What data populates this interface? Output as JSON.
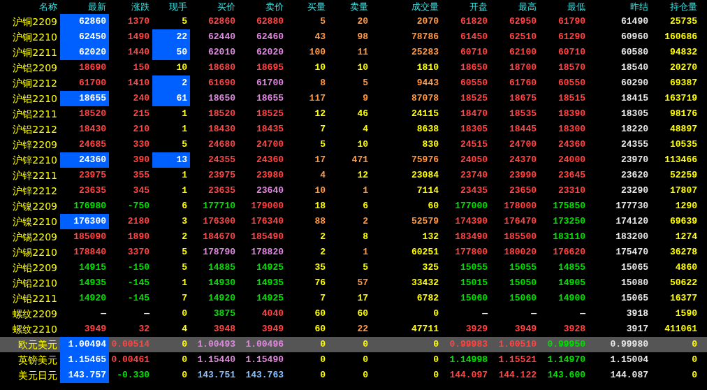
{
  "columns": [
    "名称",
    "最新",
    "涨跌",
    "现手",
    "买价",
    "卖价",
    "买量",
    "卖量",
    "成交量",
    "开盘",
    "最高",
    "最低",
    "昨结",
    "持仓量"
  ],
  "rows": [
    {
      "name": "沪铜2209",
      "selected": false,
      "last_flash": true,
      "hand_flash": false,
      "cells": [
        {
          "text": "62860",
          "color": "#ffffff"
        },
        {
          "text": "1370",
          "color": "#ff4444"
        },
        {
          "text": "5",
          "color": "#ffff00"
        },
        {
          "text": "62860",
          "color": "#ff4444"
        },
        {
          "text": "62880",
          "color": "#ff4444"
        },
        {
          "text": "5",
          "color": "#ff9944"
        },
        {
          "text": "20",
          "color": "#ff9944"
        },
        {
          "text": "2070",
          "color": "#ff9944"
        },
        {
          "text": "61820",
          "color": "#ff4444"
        },
        {
          "text": "62950",
          "color": "#ff4444"
        },
        {
          "text": "61790",
          "color": "#ff4444"
        },
        {
          "text": "61490",
          "color": "#e8e8e8"
        },
        {
          "text": "25735",
          "color": "#ffff00"
        }
      ]
    },
    {
      "name": "沪铜2210",
      "selected": false,
      "last_flash": true,
      "hand_flash": true,
      "cells": [
        {
          "text": "62450",
          "color": "#ffffff"
        },
        {
          "text": "1490",
          "color": "#ff4444"
        },
        {
          "text": "22",
          "color": "#ffffff"
        },
        {
          "text": "62440",
          "color": "#e088e0"
        },
        {
          "text": "62460",
          "color": "#e088e0"
        },
        {
          "text": "43",
          "color": "#ff9944"
        },
        {
          "text": "98",
          "color": "#ff9944"
        },
        {
          "text": "78786",
          "color": "#ff9944"
        },
        {
          "text": "61450",
          "color": "#ff4444"
        },
        {
          "text": "62510",
          "color": "#ff4444"
        },
        {
          "text": "61290",
          "color": "#ff4444"
        },
        {
          "text": "60960",
          "color": "#e8e8e8"
        },
        {
          "text": "160686",
          "color": "#ffff00"
        }
      ]
    },
    {
      "name": "沪铜2211",
      "selected": false,
      "last_flash": true,
      "hand_flash": true,
      "cells": [
        {
          "text": "62020",
          "color": "#ffffff"
        },
        {
          "text": "1440",
          "color": "#ff4444"
        },
        {
          "text": "50",
          "color": "#ffffff"
        },
        {
          "text": "62010",
          "color": "#e088e0"
        },
        {
          "text": "62020",
          "color": "#e088e0"
        },
        {
          "text": "100",
          "color": "#ff9944"
        },
        {
          "text": "11",
          "color": "#ff9944"
        },
        {
          "text": "25283",
          "color": "#ff9944"
        },
        {
          "text": "60710",
          "color": "#ff4444"
        },
        {
          "text": "62100",
          "color": "#ff4444"
        },
        {
          "text": "60710",
          "color": "#ff4444"
        },
        {
          "text": "60580",
          "color": "#e8e8e8"
        },
        {
          "text": "94832",
          "color": "#ffff00"
        }
      ]
    },
    {
      "name": "沪铝2209",
      "selected": false,
      "last_flash": false,
      "hand_flash": false,
      "cells": [
        {
          "text": "18690",
          "color": "#ff4444"
        },
        {
          "text": "150",
          "color": "#ff4444"
        },
        {
          "text": "10",
          "color": "#ffff00"
        },
        {
          "text": "18680",
          "color": "#ff4444"
        },
        {
          "text": "18695",
          "color": "#ff4444"
        },
        {
          "text": "10",
          "color": "#ffff00"
        },
        {
          "text": "10",
          "color": "#ffff00"
        },
        {
          "text": "1810",
          "color": "#ffff00"
        },
        {
          "text": "18650",
          "color": "#ff4444"
        },
        {
          "text": "18700",
          "color": "#ff4444"
        },
        {
          "text": "18570",
          "color": "#ff4444"
        },
        {
          "text": "18540",
          "color": "#e8e8e8"
        },
        {
          "text": "20270",
          "color": "#ffff00"
        }
      ]
    },
    {
      "name": "沪铜2212",
      "selected": false,
      "last_flash": false,
      "hand_flash": true,
      "cells": [
        {
          "text": "61700",
          "color": "#ff4444"
        },
        {
          "text": "1410",
          "color": "#ff4444"
        },
        {
          "text": "2",
          "color": "#ffffff"
        },
        {
          "text": "61690",
          "color": "#ff4444"
        },
        {
          "text": "61700",
          "color": "#e088e0"
        },
        {
          "text": "8",
          "color": "#ff9944"
        },
        {
          "text": "5",
          "color": "#ff9944"
        },
        {
          "text": "9443",
          "color": "#ff9944"
        },
        {
          "text": "60550",
          "color": "#ff4444"
        },
        {
          "text": "61760",
          "color": "#ff4444"
        },
        {
          "text": "60550",
          "color": "#ff4444"
        },
        {
          "text": "60290",
          "color": "#e8e8e8"
        },
        {
          "text": "69387",
          "color": "#ffff00"
        }
      ]
    },
    {
      "name": "沪铝2210",
      "selected": false,
      "last_flash": true,
      "hand_flash": true,
      "cells": [
        {
          "text": "18655",
          "color": "#ffffff"
        },
        {
          "text": "240",
          "color": "#ff4444"
        },
        {
          "text": "61",
          "color": "#ffffff"
        },
        {
          "text": "18650",
          "color": "#e088e0"
        },
        {
          "text": "18655",
          "color": "#e088e0"
        },
        {
          "text": "117",
          "color": "#ff9944"
        },
        {
          "text": "9",
          "color": "#ff9944"
        },
        {
          "text": "87078",
          "color": "#ff9944"
        },
        {
          "text": "18525",
          "color": "#ff4444"
        },
        {
          "text": "18675",
          "color": "#ff4444"
        },
        {
          "text": "18515",
          "color": "#ff4444"
        },
        {
          "text": "18415",
          "color": "#e8e8e8"
        },
        {
          "text": "163719",
          "color": "#ffff00"
        }
      ]
    },
    {
      "name": "沪铝2211",
      "selected": false,
      "last_flash": false,
      "hand_flash": false,
      "cells": [
        {
          "text": "18520",
          "color": "#ff4444"
        },
        {
          "text": "215",
          "color": "#ff4444"
        },
        {
          "text": "1",
          "color": "#ffff00"
        },
        {
          "text": "18520",
          "color": "#ff4444"
        },
        {
          "text": "18525",
          "color": "#ff4444"
        },
        {
          "text": "12",
          "color": "#ffff00"
        },
        {
          "text": "46",
          "color": "#ffff00"
        },
        {
          "text": "24115",
          "color": "#ffff00"
        },
        {
          "text": "18470",
          "color": "#ff4444"
        },
        {
          "text": "18535",
          "color": "#ff4444"
        },
        {
          "text": "18390",
          "color": "#ff4444"
        },
        {
          "text": "18305",
          "color": "#e8e8e8"
        },
        {
          "text": "98176",
          "color": "#ffff00"
        }
      ]
    },
    {
      "name": "沪铝2212",
      "selected": false,
      "last_flash": false,
      "hand_flash": false,
      "cells": [
        {
          "text": "18430",
          "color": "#ff4444"
        },
        {
          "text": "210",
          "color": "#ff4444"
        },
        {
          "text": "1",
          "color": "#ffff00"
        },
        {
          "text": "18430",
          "color": "#ff4444"
        },
        {
          "text": "18435",
          "color": "#ff4444"
        },
        {
          "text": "7",
          "color": "#ffff00"
        },
        {
          "text": "4",
          "color": "#ffff00"
        },
        {
          "text": "8638",
          "color": "#ffff00"
        },
        {
          "text": "18305",
          "color": "#ff4444"
        },
        {
          "text": "18445",
          "color": "#ff4444"
        },
        {
          "text": "18300",
          "color": "#ff4444"
        },
        {
          "text": "18220",
          "color": "#e8e8e8"
        },
        {
          "text": "48897",
          "color": "#ffff00"
        }
      ]
    },
    {
      "name": "沪锌2209",
      "selected": false,
      "last_flash": false,
      "hand_flash": false,
      "cells": [
        {
          "text": "24685",
          "color": "#ff4444"
        },
        {
          "text": "330",
          "color": "#ff4444"
        },
        {
          "text": "5",
          "color": "#ffff00"
        },
        {
          "text": "24680",
          "color": "#ff4444"
        },
        {
          "text": "24700",
          "color": "#ff4444"
        },
        {
          "text": "5",
          "color": "#ffff00"
        },
        {
          "text": "10",
          "color": "#ffff00"
        },
        {
          "text": "830",
          "color": "#ffff00"
        },
        {
          "text": "24515",
          "color": "#ff4444"
        },
        {
          "text": "24700",
          "color": "#ff4444"
        },
        {
          "text": "24360",
          "color": "#ff4444"
        },
        {
          "text": "24355",
          "color": "#e8e8e8"
        },
        {
          "text": "10535",
          "color": "#ffff00"
        }
      ]
    },
    {
      "name": "沪锌2210",
      "selected": false,
      "last_flash": true,
      "hand_flash": true,
      "cells": [
        {
          "text": "24360",
          "color": "#ffffff"
        },
        {
          "text": "390",
          "color": "#ff4444"
        },
        {
          "text": "13",
          "color": "#ffffff"
        },
        {
          "text": "24355",
          "color": "#ff4444"
        },
        {
          "text": "24360",
          "color": "#ff4444"
        },
        {
          "text": "17",
          "color": "#ff9944"
        },
        {
          "text": "471",
          "color": "#ff9944"
        },
        {
          "text": "75976",
          "color": "#ff9944"
        },
        {
          "text": "24050",
          "color": "#ff4444"
        },
        {
          "text": "24370",
          "color": "#ff4444"
        },
        {
          "text": "24000",
          "color": "#ff4444"
        },
        {
          "text": "23970",
          "color": "#e8e8e8"
        },
        {
          "text": "113466",
          "color": "#ffff00"
        }
      ]
    },
    {
      "name": "沪锌2211",
      "selected": false,
      "last_flash": false,
      "hand_flash": false,
      "cells": [
        {
          "text": "23975",
          "color": "#ff4444"
        },
        {
          "text": "355",
          "color": "#ff4444"
        },
        {
          "text": "1",
          "color": "#ffff00"
        },
        {
          "text": "23975",
          "color": "#ff4444"
        },
        {
          "text": "23980",
          "color": "#ff4444"
        },
        {
          "text": "4",
          "color": "#ff9944"
        },
        {
          "text": "12",
          "color": "#ffff00"
        },
        {
          "text": "23084",
          "color": "#ffff00"
        },
        {
          "text": "23740",
          "color": "#ff4444"
        },
        {
          "text": "23990",
          "color": "#ff4444"
        },
        {
          "text": "23645",
          "color": "#ff4444"
        },
        {
          "text": "23620",
          "color": "#e8e8e8"
        },
        {
          "text": "52259",
          "color": "#ffff00"
        }
      ]
    },
    {
      "name": "沪锌2212",
      "selected": false,
      "last_flash": false,
      "hand_flash": false,
      "cells": [
        {
          "text": "23635",
          "color": "#ff4444"
        },
        {
          "text": "345",
          "color": "#ff4444"
        },
        {
          "text": "1",
          "color": "#ffff00"
        },
        {
          "text": "23635",
          "color": "#ff4444"
        },
        {
          "text": "23640",
          "color": "#e088e0"
        },
        {
          "text": "10",
          "color": "#ff9944"
        },
        {
          "text": "1",
          "color": "#ff9944"
        },
        {
          "text": "7114",
          "color": "#ffff00"
        },
        {
          "text": "23435",
          "color": "#ff4444"
        },
        {
          "text": "23650",
          "color": "#ff4444"
        },
        {
          "text": "23310",
          "color": "#ff4444"
        },
        {
          "text": "23290",
          "color": "#e8e8e8"
        },
        {
          "text": "17807",
          "color": "#ffff00"
        }
      ]
    },
    {
      "name": "沪镍2209",
      "selected": false,
      "last_flash": false,
      "hand_flash": false,
      "cells": [
        {
          "text": "176980",
          "color": "#00e000"
        },
        {
          "text": "-750",
          "color": "#00e000"
        },
        {
          "text": "6",
          "color": "#ffff00"
        },
        {
          "text": "177710",
          "color": "#00e000"
        },
        {
          "text": "179000",
          "color": "#ff4444"
        },
        {
          "text": "18",
          "color": "#ffff00"
        },
        {
          "text": "6",
          "color": "#ffff00"
        },
        {
          "text": "60",
          "color": "#ffff00"
        },
        {
          "text": "177000",
          "color": "#00e000"
        },
        {
          "text": "178000",
          "color": "#ff4444"
        },
        {
          "text": "175850",
          "color": "#00e000"
        },
        {
          "text": "177730",
          "color": "#e8e8e8"
        },
        {
          "text": "1290",
          "color": "#ffff00"
        }
      ]
    },
    {
      "name": "沪镍2210",
      "selected": false,
      "last_flash": true,
      "hand_flash": false,
      "cells": [
        {
          "text": "176300",
          "color": "#ffffff"
        },
        {
          "text": "2180",
          "color": "#ff4444"
        },
        {
          "text": "3",
          "color": "#ffff00"
        },
        {
          "text": "176300",
          "color": "#ff4444"
        },
        {
          "text": "176340",
          "color": "#ff4444"
        },
        {
          "text": "88",
          "color": "#ff9944"
        },
        {
          "text": "2",
          "color": "#ff9944"
        },
        {
          "text": "52579",
          "color": "#ff9944"
        },
        {
          "text": "174390",
          "color": "#ff4444"
        },
        {
          "text": "176470",
          "color": "#ff4444"
        },
        {
          "text": "173250",
          "color": "#00e000"
        },
        {
          "text": "174120",
          "color": "#e8e8e8"
        },
        {
          "text": "69639",
          "color": "#ffff00"
        }
      ]
    },
    {
      "name": "沪锡2209",
      "selected": false,
      "last_flash": false,
      "hand_flash": false,
      "cells": [
        {
          "text": "185090",
          "color": "#ff4444"
        },
        {
          "text": "1890",
          "color": "#ff4444"
        },
        {
          "text": "2",
          "color": "#ffff00"
        },
        {
          "text": "184670",
          "color": "#ff4444"
        },
        {
          "text": "185490",
          "color": "#ff4444"
        },
        {
          "text": "2",
          "color": "#ffff00"
        },
        {
          "text": "8",
          "color": "#ffff00"
        },
        {
          "text": "132",
          "color": "#ffff00"
        },
        {
          "text": "183490",
          "color": "#ff4444"
        },
        {
          "text": "185500",
          "color": "#ff4444"
        },
        {
          "text": "183110",
          "color": "#00e000"
        },
        {
          "text": "183200",
          "color": "#e8e8e8"
        },
        {
          "text": "1274",
          "color": "#ffff00"
        }
      ]
    },
    {
      "name": "沪锡2210",
      "selected": false,
      "last_flash": false,
      "hand_flash": false,
      "cells": [
        {
          "text": "178840",
          "color": "#ff4444"
        },
        {
          "text": "3370",
          "color": "#ff4444"
        },
        {
          "text": "5",
          "color": "#ffff00"
        },
        {
          "text": "178790",
          "color": "#e088e0"
        },
        {
          "text": "178820",
          "color": "#e088e0"
        },
        {
          "text": "2",
          "color": "#ffff00"
        },
        {
          "text": "1",
          "color": "#ff9944"
        },
        {
          "text": "60251",
          "color": "#ffff00"
        },
        {
          "text": "177800",
          "color": "#ff4444"
        },
        {
          "text": "180020",
          "color": "#ff4444"
        },
        {
          "text": "176620",
          "color": "#ff4444"
        },
        {
          "text": "175470",
          "color": "#e8e8e8"
        },
        {
          "text": "36278",
          "color": "#ffff00"
        }
      ]
    },
    {
      "name": "沪铅2209",
      "selected": false,
      "last_flash": false,
      "hand_flash": false,
      "cells": [
        {
          "text": "14915",
          "color": "#00e000"
        },
        {
          "text": "-150",
          "color": "#00e000"
        },
        {
          "text": "5",
          "color": "#ffff00"
        },
        {
          "text": "14885",
          "color": "#00e000"
        },
        {
          "text": "14925",
          "color": "#00e000"
        },
        {
          "text": "35",
          "color": "#ffff00"
        },
        {
          "text": "5",
          "color": "#ffff00"
        },
        {
          "text": "325",
          "color": "#ffff00"
        },
        {
          "text": "15055",
          "color": "#00e000"
        },
        {
          "text": "15055",
          "color": "#00e000"
        },
        {
          "text": "14855",
          "color": "#00e000"
        },
        {
          "text": "15065",
          "color": "#e8e8e8"
        },
        {
          "text": "4860",
          "color": "#ffff00"
        }
      ]
    },
    {
      "name": "沪铅2210",
      "selected": false,
      "last_flash": false,
      "hand_flash": false,
      "cells": [
        {
          "text": "14935",
          "color": "#00e000"
        },
        {
          "text": "-145",
          "color": "#00e000"
        },
        {
          "text": "1",
          "color": "#ffff00"
        },
        {
          "text": "14930",
          "color": "#00e000"
        },
        {
          "text": "14935",
          "color": "#00e000"
        },
        {
          "text": "76",
          "color": "#ffff00"
        },
        {
          "text": "57",
          "color": "#ff9944"
        },
        {
          "text": "33432",
          "color": "#ffff00"
        },
        {
          "text": "15015",
          "color": "#00e000"
        },
        {
          "text": "15050",
          "color": "#00e000"
        },
        {
          "text": "14905",
          "color": "#00e000"
        },
        {
          "text": "15080",
          "color": "#e8e8e8"
        },
        {
          "text": "50622",
          "color": "#ffff00"
        }
      ]
    },
    {
      "name": "沪铅2211",
      "selected": false,
      "last_flash": false,
      "hand_flash": false,
      "cells": [
        {
          "text": "14920",
          "color": "#00e000"
        },
        {
          "text": "-145",
          "color": "#00e000"
        },
        {
          "text": "7",
          "color": "#ffff00"
        },
        {
          "text": "14920",
          "color": "#00e000"
        },
        {
          "text": "14925",
          "color": "#00e000"
        },
        {
          "text": "7",
          "color": "#ffff00"
        },
        {
          "text": "17",
          "color": "#ffff00"
        },
        {
          "text": "6782",
          "color": "#ffff00"
        },
        {
          "text": "15060",
          "color": "#00e000"
        },
        {
          "text": "15060",
          "color": "#00e000"
        },
        {
          "text": "14900",
          "color": "#00e000"
        },
        {
          "text": "15065",
          "color": "#e8e8e8"
        },
        {
          "text": "16377",
          "color": "#ffff00"
        }
      ]
    },
    {
      "name": "螺纹2209",
      "selected": false,
      "last_flash": false,
      "hand_flash": false,
      "cells": [
        {
          "text": "—",
          "color": "#e8e8e8"
        },
        {
          "text": "—",
          "color": "#e8e8e8"
        },
        {
          "text": "0",
          "color": "#ffff00"
        },
        {
          "text": "3875",
          "color": "#00e000"
        },
        {
          "text": "4040",
          "color": "#ff4444"
        },
        {
          "text": "60",
          "color": "#ffff00"
        },
        {
          "text": "60",
          "color": "#ffff00"
        },
        {
          "text": "0",
          "color": "#ffff00"
        },
        {
          "text": "—",
          "color": "#e8e8e8"
        },
        {
          "text": "—",
          "color": "#e8e8e8"
        },
        {
          "text": "—",
          "color": "#e8e8e8"
        },
        {
          "text": "3918",
          "color": "#e8e8e8"
        },
        {
          "text": "1590",
          "color": "#ffff00"
        }
      ]
    },
    {
      "name": "螺纹2210",
      "selected": false,
      "last_flash": false,
      "hand_flash": false,
      "cells": [
        {
          "text": "3949",
          "color": "#ff4444"
        },
        {
          "text": "32",
          "color": "#ff4444"
        },
        {
          "text": "4",
          "color": "#ffff00"
        },
        {
          "text": "3948",
          "color": "#ff4444"
        },
        {
          "text": "3949",
          "color": "#ff4444"
        },
        {
          "text": "60",
          "color": "#ffff00"
        },
        {
          "text": "22",
          "color": "#ff9944"
        },
        {
          "text": "47711",
          "color": "#ffff00"
        },
        {
          "text": "3929",
          "color": "#ff4444"
        },
        {
          "text": "3949",
          "color": "#ff4444"
        },
        {
          "text": "3928",
          "color": "#ff4444"
        },
        {
          "text": "3917",
          "color": "#e8e8e8"
        },
        {
          "text": "411061",
          "color": "#ffff00"
        }
      ]
    },
    {
      "name": "欧元美元",
      "selected": true,
      "last_flash": true,
      "hand_flash": false,
      "cells": [
        {
          "text": "1.00494",
          "color": "#ffffff"
        },
        {
          "text": "0.00514",
          "color": "#ff4444"
        },
        {
          "text": "0",
          "color": "#ffff00"
        },
        {
          "text": "1.00493",
          "color": "#e088e0"
        },
        {
          "text": "1.00496",
          "color": "#e088e0"
        },
        {
          "text": "0",
          "color": "#ffff00"
        },
        {
          "text": "0",
          "color": "#ffff00"
        },
        {
          "text": "0",
          "color": "#ffff00"
        },
        {
          "text": "0.99983",
          "color": "#ff4444"
        },
        {
          "text": "1.00510",
          "color": "#ff4444"
        },
        {
          "text": "0.99950",
          "color": "#00e000"
        },
        {
          "text": "0.99980",
          "color": "#e8e8e8"
        },
        {
          "text": "0",
          "color": "#ffff00"
        }
      ]
    },
    {
      "name": "英镑美元",
      "selected": false,
      "last_flash": true,
      "hand_flash": false,
      "cells": [
        {
          "text": "1.15465",
          "color": "#ffffff"
        },
        {
          "text": "0.00461",
          "color": "#ff4444"
        },
        {
          "text": "0",
          "color": "#ffff00"
        },
        {
          "text": "1.15440",
          "color": "#e088e0"
        },
        {
          "text": "1.15490",
          "color": "#e088e0"
        },
        {
          "text": "0",
          "color": "#ffff00"
        },
        {
          "text": "0",
          "color": "#ffff00"
        },
        {
          "text": "0",
          "color": "#ffff00"
        },
        {
          "text": "1.14998",
          "color": "#00e000"
        },
        {
          "text": "1.15521",
          "color": "#ff4444"
        },
        {
          "text": "1.14970",
          "color": "#00e000"
        },
        {
          "text": "1.15004",
          "color": "#e8e8e8"
        },
        {
          "text": "0",
          "color": "#ffff00"
        }
      ]
    },
    {
      "name": "美元日元",
      "selected": false,
      "last_flash": true,
      "hand_flash": false,
      "cells": [
        {
          "text": "143.757",
          "color": "#ffffff"
        },
        {
          "text": "-0.330",
          "color": "#00e000"
        },
        {
          "text": "0",
          "color": "#ffff00"
        },
        {
          "text": "143.751",
          "color": "#88c0ff"
        },
        {
          "text": "143.763",
          "color": "#88c0ff"
        },
        {
          "text": "0",
          "color": "#ffff00"
        },
        {
          "text": "0",
          "color": "#ffff00"
        },
        {
          "text": "0",
          "color": "#ffff00"
        },
        {
          "text": "144.097",
          "color": "#ff4444"
        },
        {
          "text": "144.122",
          "color": "#ff4444"
        },
        {
          "text": "143.600",
          "color": "#00e000"
        },
        {
          "text": "144.087",
          "color": "#e8e8e8"
        },
        {
          "text": "0",
          "color": "#ffff00"
        }
      ]
    }
  ]
}
